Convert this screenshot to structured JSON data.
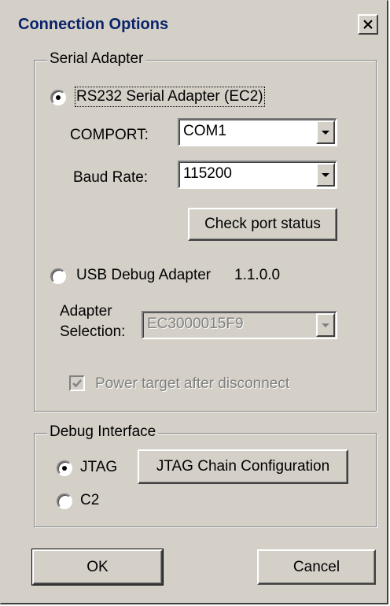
{
  "window": {
    "title": "Connection Options",
    "close_glyph": "✕"
  },
  "serial_adapter": {
    "group_label": "Serial Adapter",
    "rs232": {
      "label": "RS232 Serial Adapter (EC2)",
      "selected": true
    },
    "comport": {
      "label": "COMPORT:",
      "value": "COM1"
    },
    "baud_rate": {
      "label": "Baud Rate:",
      "value": "115200"
    },
    "check_port_button": "Check port status",
    "usb": {
      "label": "USB Debug Adapter",
      "version": "1.1.0.0",
      "selected": false
    },
    "adapter_selection": {
      "label_line1": "Adapter",
      "label_line2": "Selection:",
      "value": "EC3000015F9",
      "enabled": false
    },
    "power_target": {
      "label": "Power target after disconnect",
      "checked": true,
      "enabled": false
    }
  },
  "debug_interface": {
    "group_label": "Debug Interface",
    "jtag": {
      "label": "JTAG",
      "selected": true
    },
    "jtag_chain_button": "JTAG Chain Configuration",
    "c2": {
      "label": "C2",
      "selected": false
    }
  },
  "buttons": {
    "ok": "OK",
    "cancel": "Cancel"
  }
}
